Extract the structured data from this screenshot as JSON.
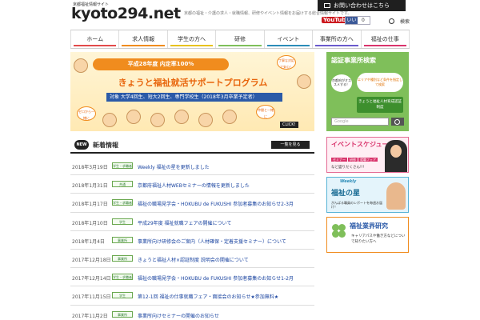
{
  "header": {
    "logo_sub": "京都福祉情報サイト",
    "logo_main": "kyoto294.net",
    "tagline": "京都の福祉・介護の求人・就職情報、研修やイベント情報をお届けする総合情報サイトです。",
    "contact": "お問い合わせはこちら",
    "youtube_label": "YouTube",
    "fb_like": "いいね",
    "fb_count": "0",
    "search_label": "検索"
  },
  "nav": {
    "items": [
      {
        "label": "ホーム",
        "color": "#e24a4a"
      },
      {
        "label": "求人情報",
        "color": "#f08c1e"
      },
      {
        "label": "学生の方へ",
        "color": "#e8c21e"
      },
      {
        "label": "研修",
        "color": "#7fbf5a"
      },
      {
        "label": "イベント",
        "color": "#2b8cb8"
      },
      {
        "label": "事業所の方へ",
        "color": "#6a5acd"
      },
      {
        "label": "福祉の仕事",
        "color": "#d9346c"
      }
    ]
  },
  "banner": {
    "ribbon": "平成28年度 内定率100%",
    "title": "きょうと福祉就活サポートプログラム",
    "target": "対象 大学4回生、短大2回生、専門学校生（2018年3月卒業予定者）",
    "bubble1": "丁寧な対応で安心！",
    "bubble2": "ゼロから一緒に",
    "bubble3": "仲間と一緒に",
    "click": "CLICK!"
  },
  "news": {
    "badge": "NEW",
    "title": "新着情報",
    "more": "一覧を見る",
    "rows": [
      {
        "date": "2018年3月19日",
        "tag": "学生・求職者",
        "text": "Weekly 福祉の星を更新しました"
      },
      {
        "date": "2018年1月31日",
        "tag": "共通",
        "text": "京都府福祉人材WEBセミナーの情報を更新しました"
      },
      {
        "date": "2018年1月17日",
        "tag": "学生・求職者",
        "text": "福祉の職場見学会・HOKUBU de FUKUSHI 参加者募集のお知らせ2-3月"
      },
      {
        "date": "2018年1月10日",
        "tag": "学生",
        "text": "平成29年度 福祉就職フェアの開催について"
      },
      {
        "date": "2018年1月4日",
        "tag": "事業所",
        "text": "事業所向け研修会のご案内（人材確保・定着支援セミナー）について"
      },
      {
        "date": "2017年12月18日",
        "tag": "事業所",
        "text": "きょうと福祉人材×認証制度 説明会の開催について"
      },
      {
        "date": "2017年12月14日",
        "tag": "学生・求職者",
        "text": "福祉の職場見学会・HOKUBU de FUKUSHI 参加者募集のお知らせ1-2月"
      },
      {
        "date": "2017年11月15日",
        "tag": "学生",
        "text": "第12-1回 福祉の仕事就職フェア・面接会のお知らせ★参加無料★"
      },
      {
        "date": "2017年11月2日",
        "tag": "事業所",
        "text": "事業所向けセミナーの開催のお知らせ"
      }
    ]
  },
  "sidebar": {
    "search": {
      "title": "認証事業所検索",
      "balloon": "京都府がオススメする！",
      "pill": "エリアや種別など条件を指定して検索",
      "badge": "きょうと福祉人材育成認証制度",
      "input_placeholder": "Google"
    },
    "event": {
      "title": "イベントスケジュール",
      "tags": [
        "セミナー",
        "研修",
        "就職フェア"
      ],
      "note": "など盛りだくさん!!!"
    },
    "weekly": {
      "kicker": "Weekly",
      "title": "福祉の星",
      "note": "がんばる職員のレポートを毎週お届け！"
    },
    "research": {
      "title": "福祉業界研究",
      "note": "キャリアパスや働き方などについて知りたい方へ"
    }
  }
}
